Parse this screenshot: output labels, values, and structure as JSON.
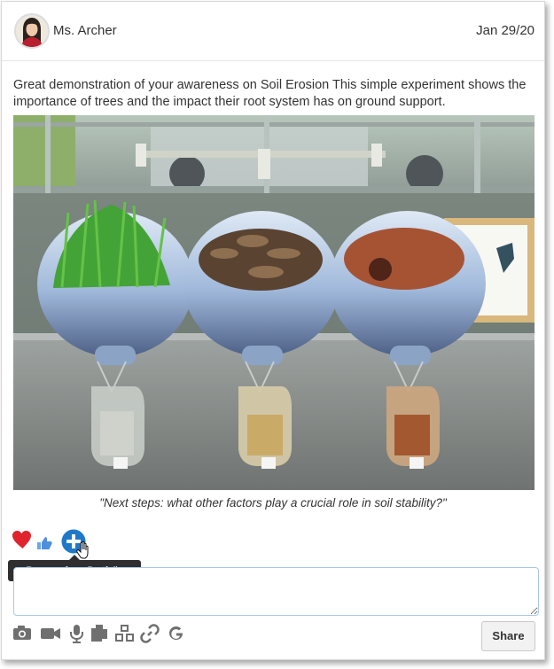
{
  "post": {
    "author": "Ms. Archer",
    "date": "Jan 29/20",
    "description": "Great demonstration of your awareness on Soil Erosion This simple experiment shows the importance of trees and the impact their root system has on ground support.",
    "caption": "\"Next steps: what other factors play a crucial role in soil stability?\""
  },
  "reactions": {
    "heart_icon": "heart-icon",
    "like_icon": "thumbs-up-icon",
    "add_icon": "plus-circle-icon",
    "tooltip": "Remove from Portfolio"
  },
  "comment": {
    "placeholder": ""
  },
  "toolbar": {
    "icons": [
      "camera-icon",
      "video-icon",
      "microphone-icon",
      "copy-icon",
      "blocks-icon",
      "link-icon",
      "google-icon"
    ],
    "share_label": "Share"
  },
  "colors": {
    "heart": "#e0242d",
    "like": "#4f8fdc",
    "add": "#1f78c8",
    "tooltip_bg": "#2f2f2f",
    "comment_border": "#a9c9e6"
  }
}
